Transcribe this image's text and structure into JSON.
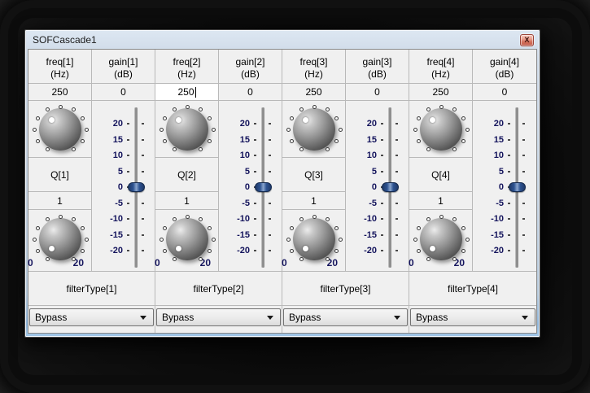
{
  "window": {
    "title": "SOFCascade1"
  },
  "icons": {
    "close": "X"
  },
  "colors": {
    "titlebar_top": "#dde7f2",
    "titlebar_bottom": "#a3c8e8",
    "client_bg": "#f0f0f0",
    "grid_line": "#b9b9b9",
    "tick_label_navy": "#14145c",
    "slider_thumb_blue": "#2d5290",
    "close_button_red": "#d5745f",
    "focused_field_bg": "#ffffff"
  },
  "slider": {
    "ticks": [
      "20",
      "15",
      "10",
      "5",
      "0",
      "-5",
      "-10",
      "-15",
      "-20"
    ],
    "value": "0"
  },
  "channels": [
    {
      "freq_label": "freq[1]",
      "freq_unit": "(Hz)",
      "freq_value": "250",
      "freq_value_class": "cell value fv",
      "gain_label": "gain[1]",
      "gain_unit": "(dB)",
      "gain_value": "0",
      "q_label": "Q[1]",
      "q_value": "1",
      "q_min": "0",
      "q_max": "20",
      "filter_type_label": "filterType[1]",
      "filter_type_value": "Bypass"
    },
    {
      "freq_label": "freq[2]",
      "freq_unit": "(Hz)",
      "freq_value": "250",
      "freq_value_class": "cell value fv focused",
      "gain_label": "gain[2]",
      "gain_unit": "(dB)",
      "gain_value": "0",
      "q_label": "Q[2]",
      "q_value": "1",
      "q_min": "0",
      "q_max": "20",
      "filter_type_label": "filterType[2]",
      "filter_type_value": "Bypass"
    },
    {
      "freq_label": "freq[3]",
      "freq_unit": "(Hz)",
      "freq_value": "250",
      "freq_value_class": "cell value fv",
      "gain_label": "gain[3]",
      "gain_unit": "(dB)",
      "gain_value": "0",
      "q_label": "Q[3]",
      "q_value": "1",
      "q_min": "0",
      "q_max": "20",
      "filter_type_label": "filterType[3]",
      "filter_type_value": "Bypass"
    },
    {
      "freq_label": "freq[4]",
      "freq_unit": "(Hz)",
      "freq_value": "250",
      "freq_value_class": "cell value fv",
      "gain_label": "gain[4]",
      "gain_unit": "(dB)",
      "gain_value": "0",
      "q_label": "Q[4]",
      "q_value": "1",
      "q_min": "0",
      "q_max": "20",
      "filter_type_label": "filterType[4]",
      "filter_type_value": "Bypass"
    }
  ]
}
